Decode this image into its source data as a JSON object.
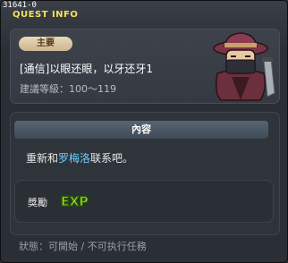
{
  "window": {
    "quest_id": "31641-0",
    "title": "QUEST INFO"
  },
  "summary": {
    "badge": "主要",
    "quest_name": "[通信]以眼还眼，以牙还牙1",
    "level_label": "建議等級：100～119"
  },
  "content": {
    "header": "內容",
    "text_before": "重新和",
    "npc_name": "罗梅洛",
    "text_after": "联系吧。"
  },
  "reward": {
    "label": "獎勵",
    "exp_text": "EXP"
  },
  "status": {
    "text": "狀態：可開始 / 不可执行任務"
  },
  "colors": {
    "title": "#f2e25a",
    "npc_highlight": "#6ad0ff",
    "exp_green": "#9bea2a"
  }
}
